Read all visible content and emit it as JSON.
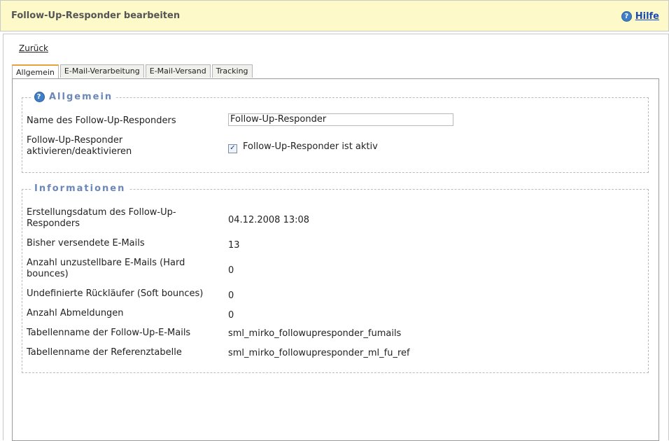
{
  "header": {
    "title": "Follow-Up-Responder bearbeiten",
    "help_label": "Hilfe",
    "help_icon": "help-icon"
  },
  "nav": {
    "back_label": "Zurück"
  },
  "tabs": [
    {
      "label": "Allgemein",
      "active": true
    },
    {
      "label": "E-Mail-Verarbeitung",
      "active": false
    },
    {
      "label": "E-Mail-Versand",
      "active": false
    },
    {
      "label": "Tracking",
      "active": false
    }
  ],
  "general": {
    "legend": "Allgemein",
    "name_label": "Name des Follow-Up-Responders",
    "name_value": "Follow-Up-Responder",
    "active_label": "Follow-Up-Responder aktivieren/deaktivieren",
    "active_checked": true,
    "active_checkbox_label": "Follow-Up-Responder ist aktiv"
  },
  "info": {
    "legend": "Informationen",
    "rows": [
      {
        "label": "Erstellungsdatum des Follow-Up-Responders",
        "value": "04.12.2008 13:08"
      },
      {
        "label": "Bisher versendete E-Mails",
        "value": "13"
      },
      {
        "label": "Anzahl unzustellbare E-Mails (Hard bounces)",
        "value": "0"
      },
      {
        "label": "Undefinierte Rückläufer (Soft bounces)",
        "value": "0"
      },
      {
        "label": "Anzahl Abmeldungen",
        "value": "0"
      },
      {
        "label": "Tabellenname der Follow-Up-E-Mails",
        "value": "sml_mirko_followupresponder_fumails"
      },
      {
        "label": "Tabellenname der Referenztabelle",
        "value": "sml_mirko_followupresponder_ml_fu_ref"
      }
    ]
  },
  "colors": {
    "header_bg": "#fdf9c8",
    "legend": "#6b87b7",
    "link": "#1a4ab8",
    "active_tab_accent": "#e8a13b"
  }
}
